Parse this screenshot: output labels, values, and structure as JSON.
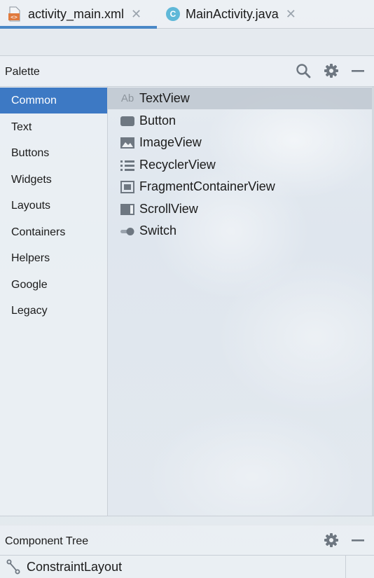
{
  "tabs": [
    {
      "label": "activity_main.xml",
      "icon": "xml-layout-file-icon",
      "active": true
    },
    {
      "label": "MainActivity.java",
      "icon": "java-class-icon",
      "icon_letter": "C",
      "active": false
    }
  ],
  "close_glyph": "✕",
  "palette": {
    "title": "Palette",
    "categories": [
      {
        "label": "Common",
        "selected": true
      },
      {
        "label": "Text"
      },
      {
        "label": "Buttons"
      },
      {
        "label": "Widgets"
      },
      {
        "label": "Layouts"
      },
      {
        "label": "Containers"
      },
      {
        "label": "Helpers"
      },
      {
        "label": "Google"
      },
      {
        "label": "Legacy"
      }
    ],
    "components": [
      {
        "label": "TextView",
        "icon": "textview-icon",
        "icon_text": "Ab",
        "selected": true
      },
      {
        "label": "Button",
        "icon": "button-icon"
      },
      {
        "label": "ImageView",
        "icon": "imageview-icon"
      },
      {
        "label": "RecyclerView",
        "icon": "recyclerview-icon"
      },
      {
        "label": "FragmentContainerView",
        "icon": "fragment-container-icon"
      },
      {
        "label": "ScrollView",
        "icon": "scrollview-icon"
      },
      {
        "label": "Switch",
        "icon": "switch-icon"
      }
    ]
  },
  "component_tree": {
    "title": "Component Tree",
    "root": {
      "label": "ConstraintLayout",
      "icon": "constraint-layout-icon"
    }
  },
  "colors": {
    "accent": "#3d79c4",
    "tab_underline": "#4a88c7",
    "icon_gray": "#6e7781",
    "java_icon": "#5fb8d8"
  }
}
